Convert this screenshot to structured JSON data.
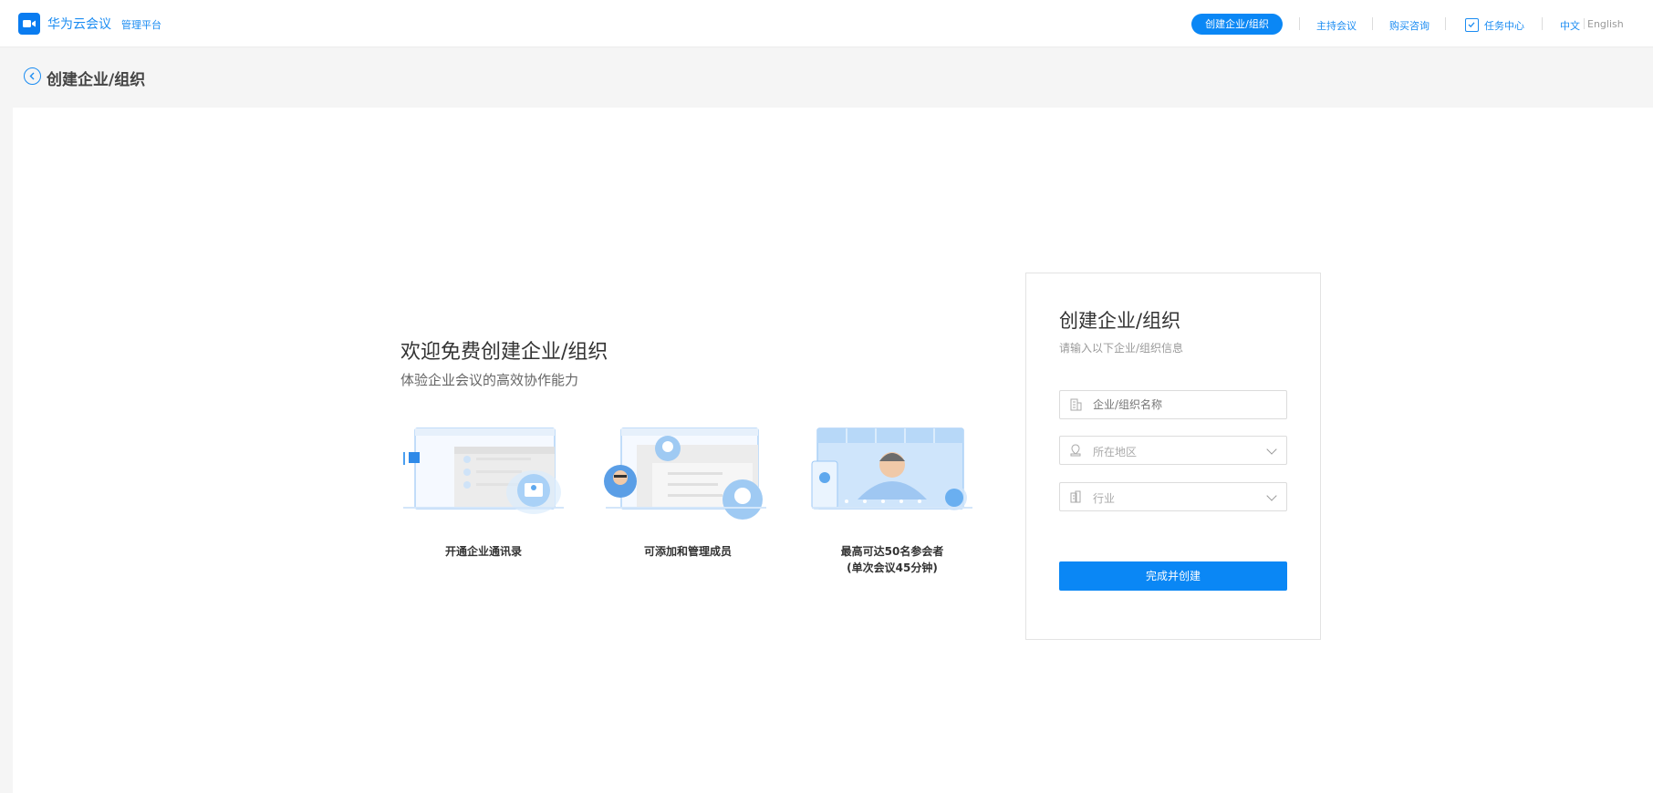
{
  "header": {
    "brand": "华为云会议",
    "brand_sub": "管理平台",
    "nav": {
      "create_org": "创建企业/组织",
      "host_meeting": "主持会议",
      "buy_consult": "购买咨询",
      "task_center": "任务中心",
      "lang_zh": "中文",
      "lang_en": "English"
    }
  },
  "page": {
    "title": "创建企业/组织"
  },
  "welcome": {
    "title": "欢迎免费创建企业/组织",
    "subtitle": "体验企业会议的高效协作能力",
    "features": [
      {
        "label": "开通企业通讯录",
        "icon": "contacts-illustration"
      },
      {
        "label": "可添加和管理成员",
        "icon": "members-illustration"
      },
      {
        "label": "最高可达50名参会者",
        "label2": "(单次会议45分钟)",
        "icon": "meeting-illustration"
      }
    ]
  },
  "form": {
    "title": "创建企业/组织",
    "subtitle": "请输入以下企业/组织信息",
    "fields": {
      "name_placeholder": "企业/组织名称",
      "region_placeholder": "所在地区",
      "industry_placeholder": "行业"
    },
    "submit_label": "完成并创建"
  },
  "colors": {
    "primary": "#0a87f5",
    "link": "#1b8cf2"
  }
}
